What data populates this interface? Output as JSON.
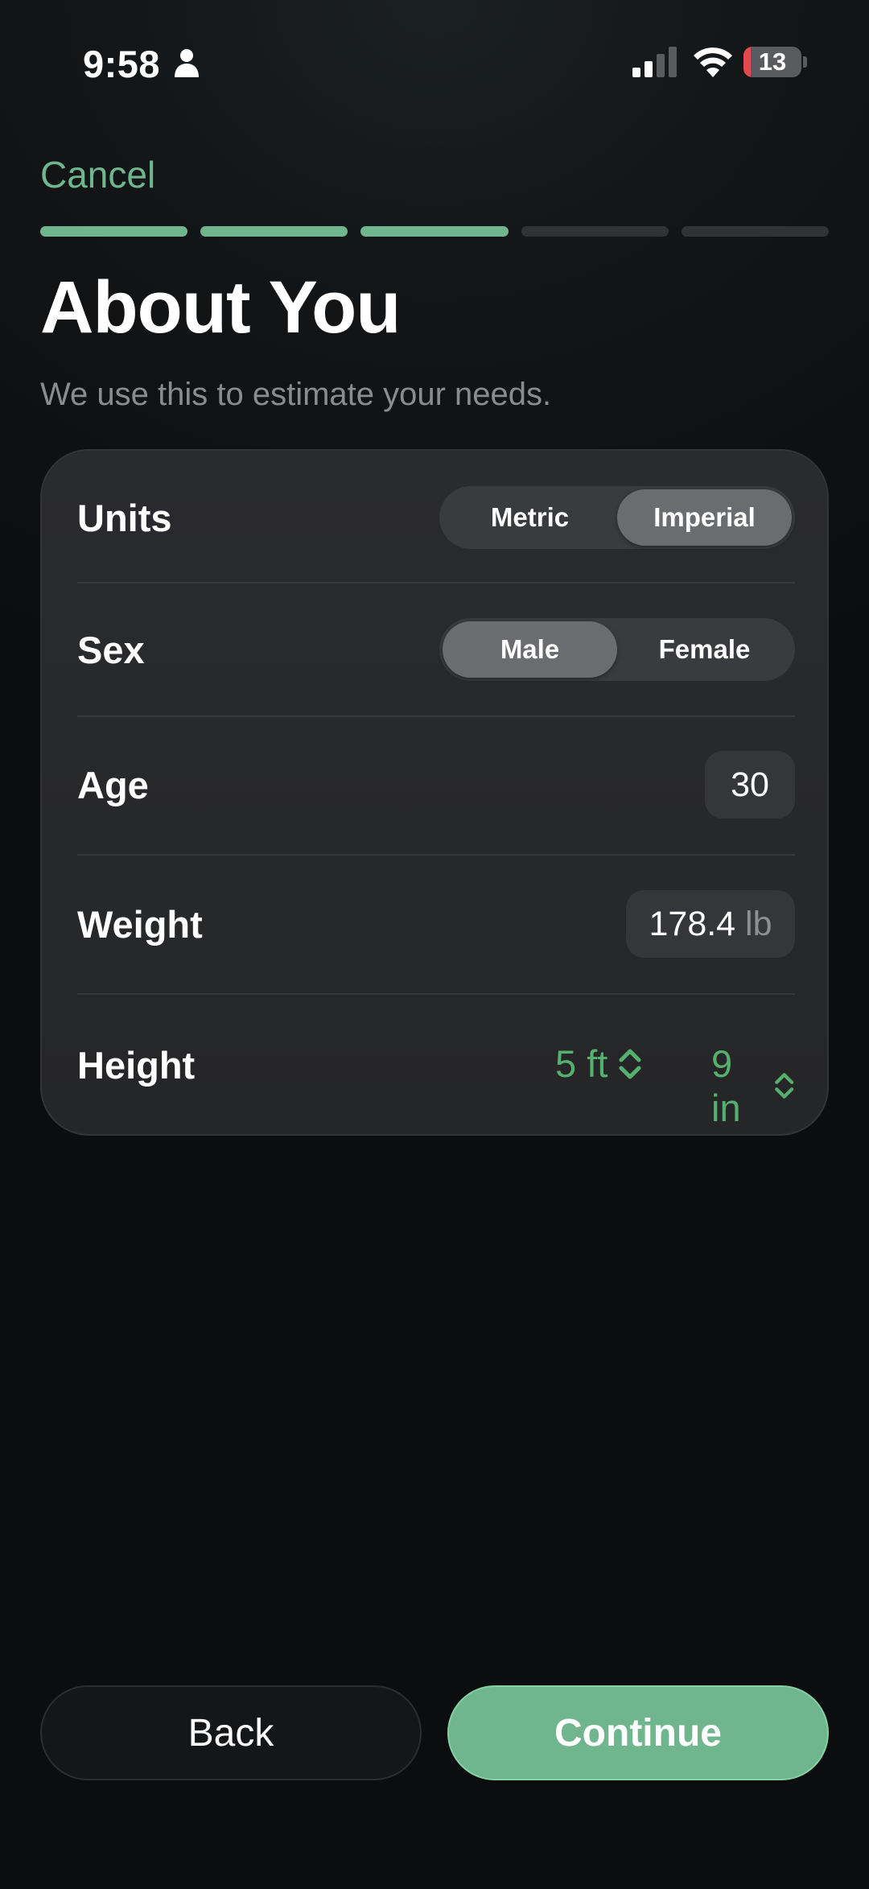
{
  "status_bar": {
    "time": "9:58",
    "battery_level": "13",
    "battery_fraction": 0.13,
    "icons": [
      "person-icon",
      "cellular-signal-icon",
      "wifi-icon",
      "battery-icon"
    ]
  },
  "header": {
    "cancel_label": "Cancel",
    "progress": {
      "total_steps": 5,
      "completed_steps": 3
    },
    "title": "About You",
    "subtitle": "We use this to estimate your needs."
  },
  "form": {
    "units": {
      "label": "Units",
      "options": [
        "Metric",
        "Imperial"
      ],
      "selected": "Imperial"
    },
    "sex": {
      "label": "Sex",
      "options": [
        "Male",
        "Female"
      ],
      "selected": "Male"
    },
    "age": {
      "label": "Age",
      "value": "30"
    },
    "weight": {
      "label": "Weight",
      "value": "178.4",
      "unit": "lb"
    },
    "height": {
      "label": "Height",
      "feet": "5 ft",
      "inches": "9 in"
    }
  },
  "footer": {
    "back_label": "Back",
    "continue_label": "Continue"
  },
  "colors": {
    "accent": "#6fb58e",
    "stepper_text": "#55b06f",
    "background": "#0c0d0f",
    "card": "#28292c",
    "battery_low": "#e5484d"
  }
}
